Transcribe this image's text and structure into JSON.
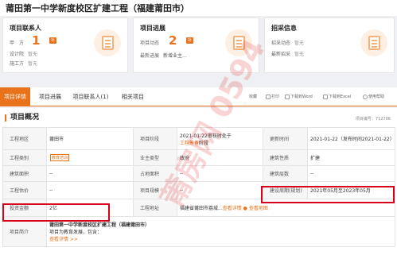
{
  "page": {
    "title": "莆田第一中学新度校区扩建工程（福建莆田市）"
  },
  "cards": {
    "contact": {
      "title": "项目联系人",
      "rows": [
        {
          "label": "甲　方",
          "count": "1",
          "badge": "补"
        },
        {
          "label": "设计院",
          "value": "暂无"
        },
        {
          "label": "施工方",
          "value": "暂无"
        }
      ]
    },
    "progress": {
      "title": "项目进展",
      "rows": [
        {
          "label": "项目动态",
          "count": "2",
          "badge": "补"
        },
        {
          "label": "最新进展",
          "value": "新增业主..."
        }
      ]
    },
    "bidding": {
      "title": "招采信息",
      "rows": [
        {
          "label": "招采动态",
          "value": "暂无"
        },
        {
          "label": "最新招采",
          "value": "暂无"
        }
      ]
    }
  },
  "tabs": [
    {
      "label": "项目详情",
      "active": true
    },
    {
      "label": "项目进展"
    },
    {
      "label": "项目联系人(1)"
    },
    {
      "label": "相关项目"
    }
  ],
  "actions": {
    "favorite": "收藏",
    "print": "打印",
    "download_word": "下载到Word",
    "download_excel": "下载到Excel",
    "help": "使用帮助"
  },
  "section": {
    "title": "项目概况",
    "code_label": "项目编号：",
    "code": "712706"
  },
  "table": {
    "row1": {
      "l1": "工程地区",
      "v1": "莆田市",
      "l2": "项目阶段",
      "v2a": "2021-01-22审核时处于",
      "v2b": "工程筹备",
      "v2c": "阶段",
      "l3": "更新时间",
      "v3": "2021-01-22（发布时间2021-01-22）"
    },
    "row2": {
      "l1": "工程类别",
      "v1": "教育培训",
      "l2": "业主类型",
      "v2": "政府",
      "l3": "建筑性质",
      "v3": "扩建"
    },
    "row3": {
      "l1": "建筑面积",
      "v1": "--",
      "l2": "占地面积",
      "v2": "--",
      "l3": "建筑层数",
      "v3": "--"
    },
    "row4": {
      "l1": "工程估价",
      "v1": "--",
      "l2": "项目规模",
      "v2": "--",
      "l3": "建设周期(规划)",
      "v3": "2021年05月至2023年05月"
    },
    "row5": {
      "l1": "投资金额",
      "v1": "2亿",
      "l2": "工程地址",
      "v2": "福建省莆田市荔城...",
      "v2_link": "查看详情",
      "v2_map": "查看地图"
    },
    "row6": {
      "l1": "项目简介",
      "intro_title": "莆田第一中学新度校区扩建工程（福建莆田市）",
      "intro_text": "项目为教育发展，包含：",
      "intro_link": "查看详情 >>"
    }
  },
  "watermark": "莆房网 0594",
  "colors": {
    "accent": "#e8731a",
    "highlight_box": "#d9001b"
  }
}
